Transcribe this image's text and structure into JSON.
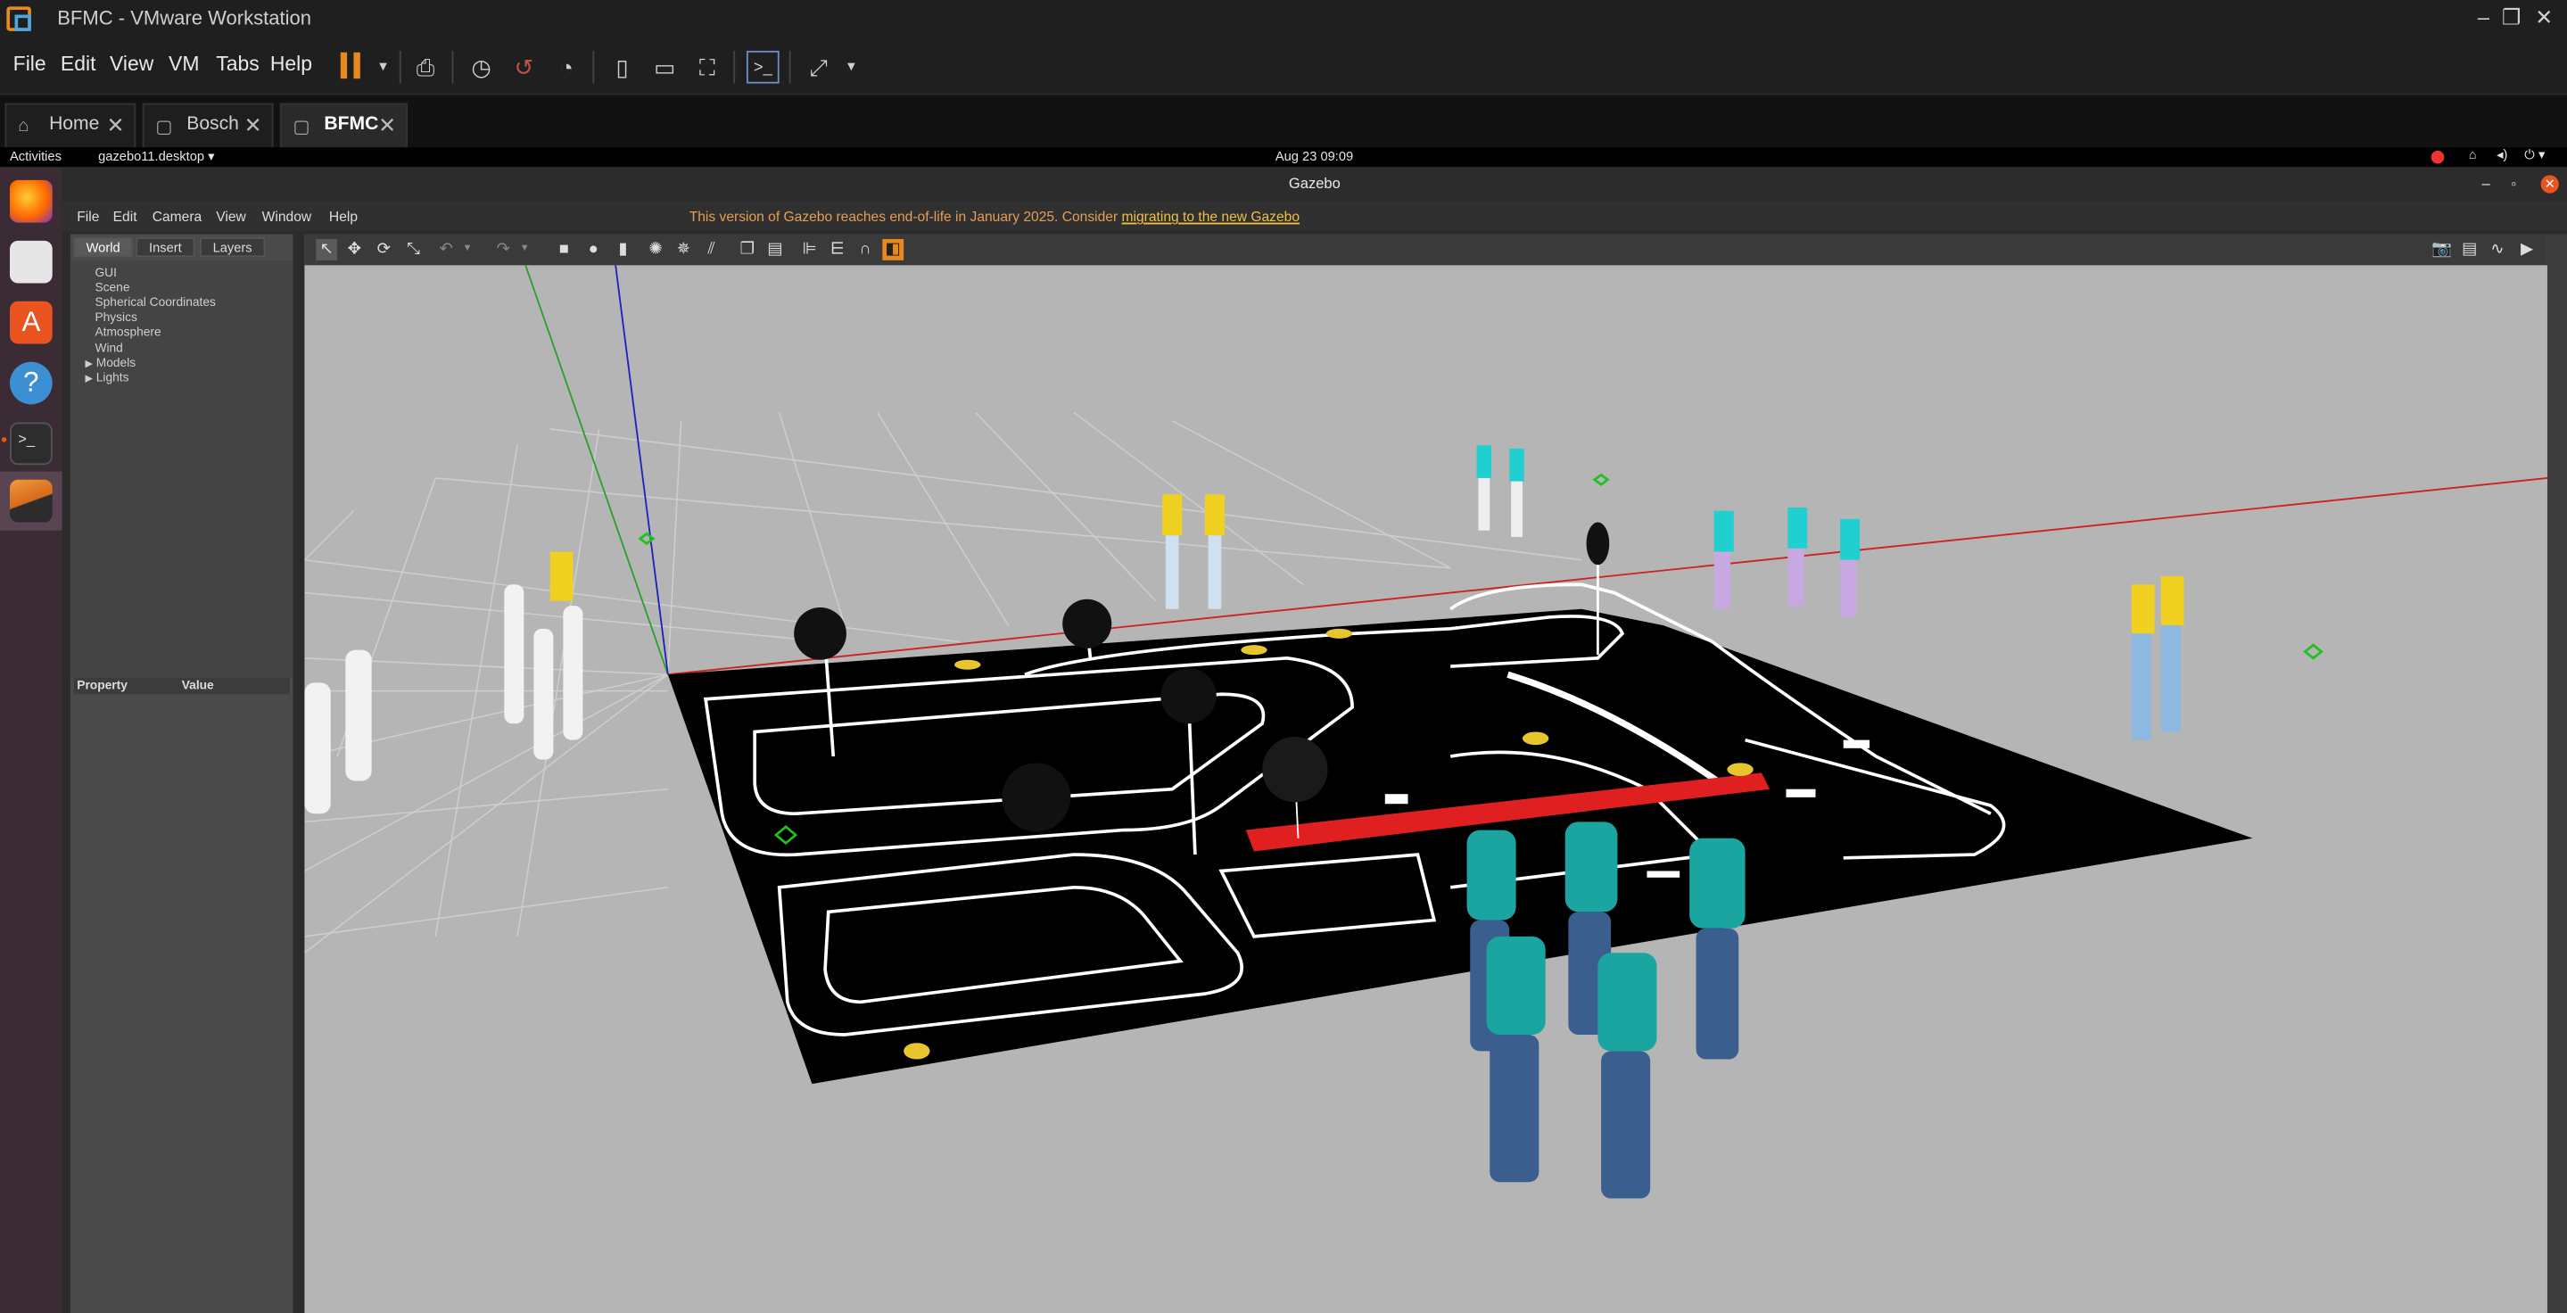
{
  "vmware": {
    "title": "BFMC - VMware Workstation",
    "menu": [
      "File",
      "Edit",
      "View",
      "VM",
      "Tabs",
      "Help"
    ],
    "tabs": [
      {
        "label": "Home",
        "icon": "home-icon"
      },
      {
        "label": "Bosch",
        "icon": "vm-icon"
      },
      {
        "label": "BFMC",
        "icon": "vm-icon",
        "active": true
      }
    ],
    "accent": "#e8891d"
  },
  "ubuntu": {
    "activities": "Activities",
    "app": "gazebo11.desktop",
    "clock": "Aug 23  09:09",
    "dock": [
      "firefox-icon",
      "files-icon",
      "app-center-icon",
      "help-icon",
      "terminal-icon",
      "gazebo-icon"
    ]
  },
  "gazebo": {
    "title": "Gazebo",
    "menu": [
      "File",
      "Edit",
      "Camera",
      "View",
      "Window",
      "Help"
    ],
    "eol_notice": "This version of Gazebo reaches end-of-life in January 2025. Consider",
    "eol_link": "migrating to the new Gazebo",
    "panel_tabs": [
      "World",
      "Insert",
      "Layers"
    ],
    "tree": [
      "GUI",
      "Scene",
      "Spherical Coordinates",
      "Physics",
      "Atmosphere",
      "Wind",
      "Models",
      "Lights"
    ],
    "prop_headers": [
      "Property",
      "Value"
    ],
    "sky_color": "#b5b5b5"
  }
}
